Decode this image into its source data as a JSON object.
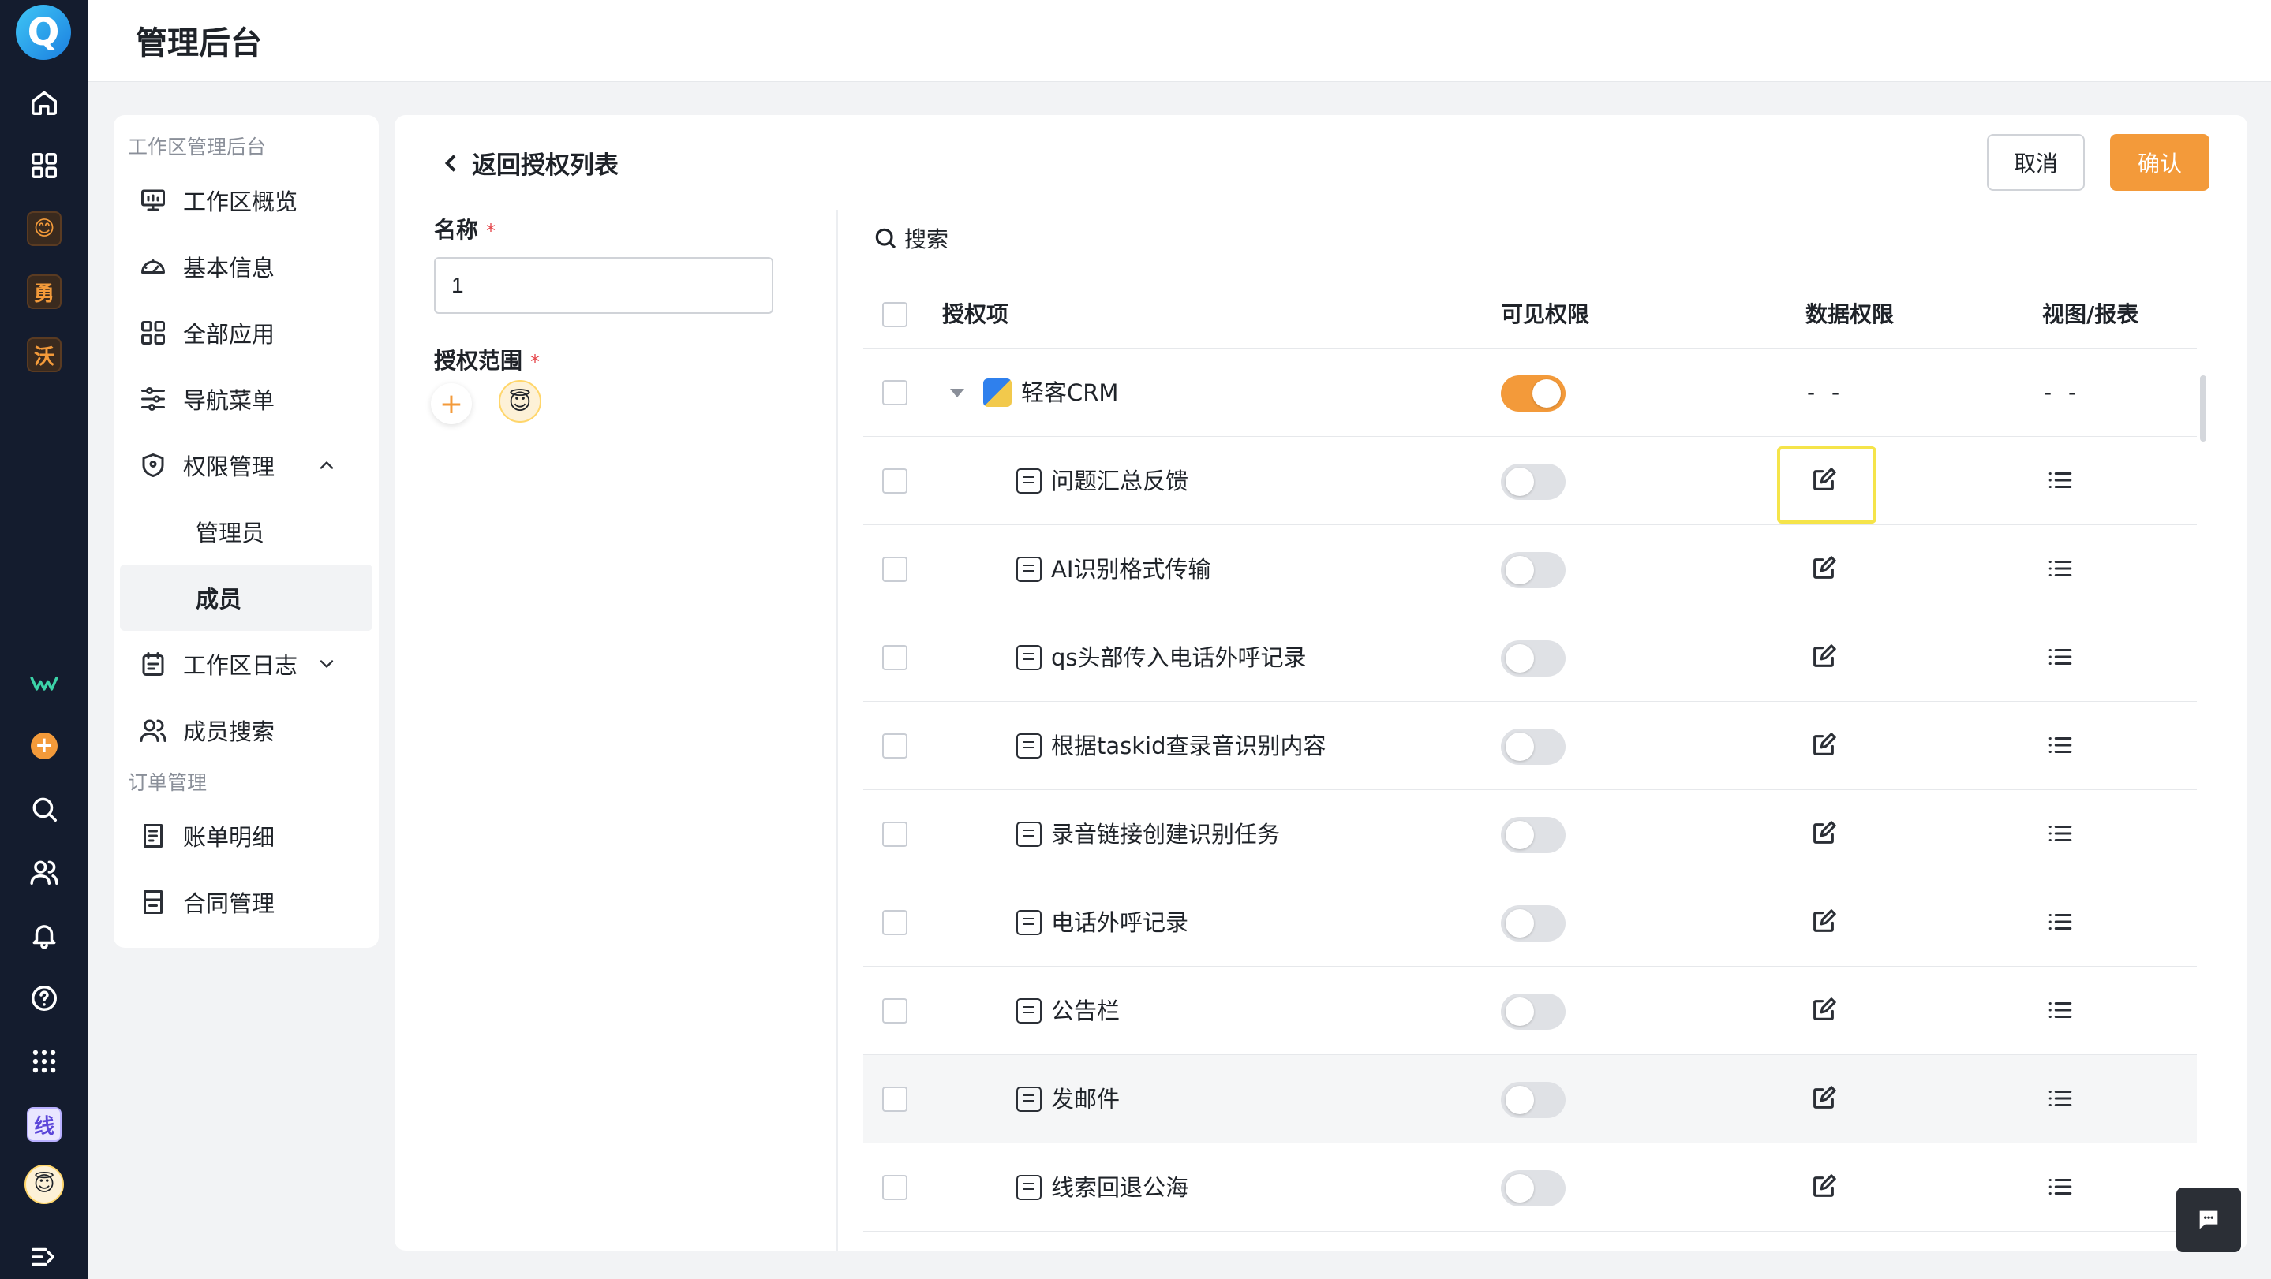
{
  "header": {
    "title": "管理后台"
  },
  "rail": {
    "logo": "Q",
    "apps": [
      "😊",
      "勇",
      "沃"
    ],
    "bottom_app": "线"
  },
  "sidemenu": {
    "group1": "工作区管理后台",
    "items": [
      {
        "label": "工作区概览",
        "icon": "monitor-icon"
      },
      {
        "label": "基本信息",
        "icon": "gauge-icon"
      },
      {
        "label": "全部应用",
        "icon": "grid-icon"
      },
      {
        "label": "导航菜单",
        "icon": "sliders-icon"
      },
      {
        "label": "权限管理",
        "icon": "shield-icon"
      }
    ],
    "sub": [
      "管理员",
      "成员"
    ],
    "items2": [
      {
        "label": "工作区日志",
        "icon": "calendar-icon"
      },
      {
        "label": "成员搜索",
        "icon": "users-icon"
      }
    ],
    "group2": "订单管理",
    "items3": [
      {
        "label": "账单明细",
        "icon": "receipt-icon"
      },
      {
        "label": "合同管理",
        "icon": "contract-icon"
      }
    ]
  },
  "main": {
    "back_label": "返回授权列表",
    "cancel_label": "取消",
    "confirm_label": "确认",
    "name_label": "名称",
    "required_mark": "*",
    "name_value": "1",
    "scope_label": "授权范围",
    "search_label": "搜索"
  },
  "table": {
    "headers": {
      "item": "授权项",
      "visible": "可见权限",
      "data": "数据权限",
      "view": "视图/报表"
    },
    "parent": {
      "name": "轻客CRM",
      "visible": true,
      "data": "- -",
      "view": "- -"
    },
    "rows": [
      {
        "name": "问题汇总反馈",
        "visible": false
      },
      {
        "name": "AI识别格式传输",
        "visible": false
      },
      {
        "name": "qs头部传入电话外呼记录",
        "visible": false
      },
      {
        "name": "根据taskid查录音识别内容",
        "visible": false
      },
      {
        "name": "录音链接创建识别任务",
        "visible": false
      },
      {
        "name": "电话外呼记录",
        "visible": false
      },
      {
        "name": "公告栏",
        "visible": false
      },
      {
        "name": "发邮件",
        "visible": false
      },
      {
        "name": "线索回退公海",
        "visible": false
      }
    ]
  },
  "colors": {
    "accent": "#f39a3a",
    "rail_bg": "#141c2e",
    "highlight": "#f5e44a"
  }
}
